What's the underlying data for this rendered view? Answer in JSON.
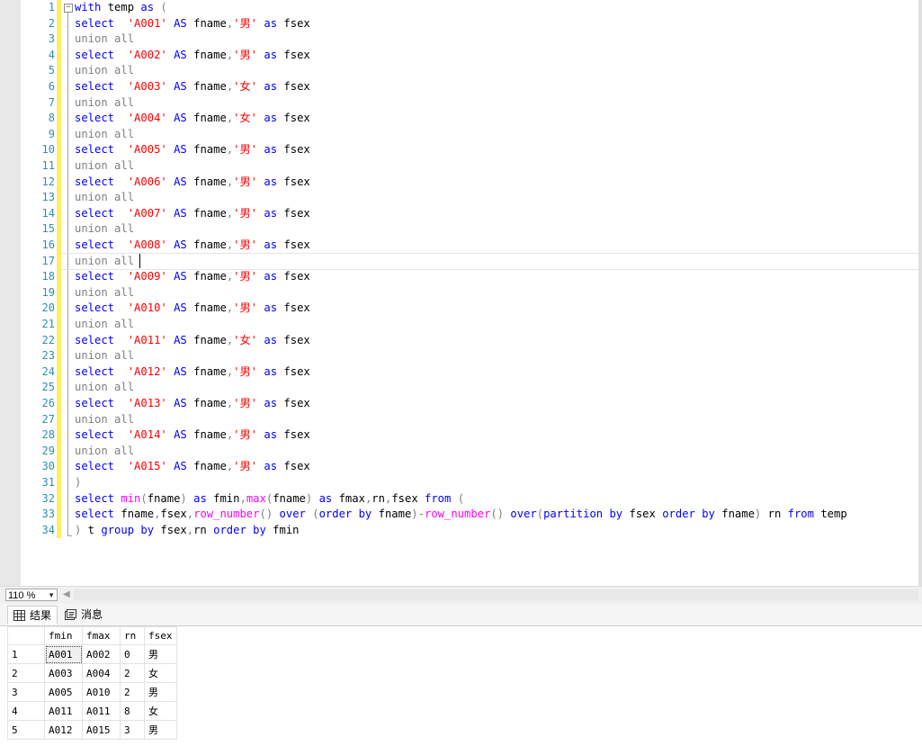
{
  "editor": {
    "line_numbers": [
      "1",
      "2",
      "3",
      "4",
      "5",
      "6",
      "7",
      "8",
      "9",
      "10",
      "11",
      "12",
      "13",
      "14",
      "15",
      "16",
      "17",
      "18",
      "19",
      "20",
      "21",
      "22",
      "23",
      "24",
      "25",
      "26",
      "27",
      "28",
      "29",
      "30",
      "31",
      "32",
      "33",
      "34"
    ],
    "outline_toggle": "−",
    "lines": [
      [
        {
          "t": "with",
          "c": "kw"
        },
        {
          "t": " temp ",
          "c": ""
        },
        {
          "t": "as",
          "c": "kw"
        },
        {
          "t": " (",
          "c": "gr"
        }
      ],
      [
        {
          "t": "select",
          "c": "kw"
        },
        {
          "t": "  ",
          "c": ""
        },
        {
          "t": "'A001'",
          "c": "st"
        },
        {
          "t": " ",
          "c": ""
        },
        {
          "t": "AS",
          "c": "kw"
        },
        {
          "t": " fname",
          "c": ""
        },
        {
          "t": ",",
          "c": "gr"
        },
        {
          "t": "'男'",
          "c": "st"
        },
        {
          "t": " ",
          "c": ""
        },
        {
          "t": "as",
          "c": "kw"
        },
        {
          "t": " fsex",
          "c": ""
        }
      ],
      [
        {
          "t": "union all",
          "c": "gr"
        }
      ],
      [
        {
          "t": "select",
          "c": "kw"
        },
        {
          "t": "  ",
          "c": ""
        },
        {
          "t": "'A002'",
          "c": "st"
        },
        {
          "t": " ",
          "c": ""
        },
        {
          "t": "AS",
          "c": "kw"
        },
        {
          "t": " fname",
          "c": ""
        },
        {
          "t": ",",
          "c": "gr"
        },
        {
          "t": "'男'",
          "c": "st"
        },
        {
          "t": " ",
          "c": ""
        },
        {
          "t": "as",
          "c": "kw"
        },
        {
          "t": " fsex",
          "c": ""
        }
      ],
      [
        {
          "t": "union all",
          "c": "gr"
        }
      ],
      [
        {
          "t": "select",
          "c": "kw"
        },
        {
          "t": "  ",
          "c": ""
        },
        {
          "t": "'A003'",
          "c": "st"
        },
        {
          "t": " ",
          "c": ""
        },
        {
          "t": "AS",
          "c": "kw"
        },
        {
          "t": " fname",
          "c": ""
        },
        {
          "t": ",",
          "c": "gr"
        },
        {
          "t": "'女'",
          "c": "st"
        },
        {
          "t": " ",
          "c": ""
        },
        {
          "t": "as",
          "c": "kw"
        },
        {
          "t": " fsex",
          "c": ""
        }
      ],
      [
        {
          "t": "union all",
          "c": "gr"
        }
      ],
      [
        {
          "t": "select",
          "c": "kw"
        },
        {
          "t": "  ",
          "c": ""
        },
        {
          "t": "'A004'",
          "c": "st"
        },
        {
          "t": " ",
          "c": ""
        },
        {
          "t": "AS",
          "c": "kw"
        },
        {
          "t": " fname",
          "c": ""
        },
        {
          "t": ",",
          "c": "gr"
        },
        {
          "t": "'女'",
          "c": "st"
        },
        {
          "t": " ",
          "c": ""
        },
        {
          "t": "as",
          "c": "kw"
        },
        {
          "t": " fsex",
          "c": ""
        }
      ],
      [
        {
          "t": "union all",
          "c": "gr"
        }
      ],
      [
        {
          "t": "select",
          "c": "kw"
        },
        {
          "t": "  ",
          "c": ""
        },
        {
          "t": "'A005'",
          "c": "st"
        },
        {
          "t": " ",
          "c": ""
        },
        {
          "t": "AS",
          "c": "kw"
        },
        {
          "t": " fname",
          "c": ""
        },
        {
          "t": ",",
          "c": "gr"
        },
        {
          "t": "'男'",
          "c": "st"
        },
        {
          "t": " ",
          "c": ""
        },
        {
          "t": "as",
          "c": "kw"
        },
        {
          "t": " fsex",
          "c": ""
        }
      ],
      [
        {
          "t": "union all",
          "c": "gr"
        }
      ],
      [
        {
          "t": "select",
          "c": "kw"
        },
        {
          "t": "  ",
          "c": ""
        },
        {
          "t": "'A006'",
          "c": "st"
        },
        {
          "t": " ",
          "c": ""
        },
        {
          "t": "AS",
          "c": "kw"
        },
        {
          "t": " fname",
          "c": ""
        },
        {
          "t": ",",
          "c": "gr"
        },
        {
          "t": "'男'",
          "c": "st"
        },
        {
          "t": " ",
          "c": ""
        },
        {
          "t": "as",
          "c": "kw"
        },
        {
          "t": " fsex",
          "c": ""
        }
      ],
      [
        {
          "t": "union all",
          "c": "gr"
        }
      ],
      [
        {
          "t": "select",
          "c": "kw"
        },
        {
          "t": "  ",
          "c": ""
        },
        {
          "t": "'A007'",
          "c": "st"
        },
        {
          "t": " ",
          "c": ""
        },
        {
          "t": "AS",
          "c": "kw"
        },
        {
          "t": " fname",
          "c": ""
        },
        {
          "t": ",",
          "c": "gr"
        },
        {
          "t": "'男'",
          "c": "st"
        },
        {
          "t": " ",
          "c": ""
        },
        {
          "t": "as",
          "c": "kw"
        },
        {
          "t": " fsex",
          "c": ""
        }
      ],
      [
        {
          "t": "union all",
          "c": "gr"
        }
      ],
      [
        {
          "t": "select",
          "c": "kw"
        },
        {
          "t": "  ",
          "c": ""
        },
        {
          "t": "'A008'",
          "c": "st"
        },
        {
          "t": " ",
          "c": ""
        },
        {
          "t": "AS",
          "c": "kw"
        },
        {
          "t": " fname",
          "c": ""
        },
        {
          "t": ",",
          "c": "gr"
        },
        {
          "t": "'男'",
          "c": "st"
        },
        {
          "t": " ",
          "c": ""
        },
        {
          "t": "as",
          "c": "kw"
        },
        {
          "t": " fsex",
          "c": ""
        }
      ],
      [
        {
          "t": "union all",
          "c": "gr"
        }
      ],
      [
        {
          "t": "select",
          "c": "kw"
        },
        {
          "t": "  ",
          "c": ""
        },
        {
          "t": "'A009'",
          "c": "st"
        },
        {
          "t": " ",
          "c": ""
        },
        {
          "t": "AS",
          "c": "kw"
        },
        {
          "t": " fname",
          "c": ""
        },
        {
          "t": ",",
          "c": "gr"
        },
        {
          "t": "'男'",
          "c": "st"
        },
        {
          "t": " ",
          "c": ""
        },
        {
          "t": "as",
          "c": "kw"
        },
        {
          "t": " fsex",
          "c": ""
        }
      ],
      [
        {
          "t": "union all",
          "c": "gr"
        }
      ],
      [
        {
          "t": "select",
          "c": "kw"
        },
        {
          "t": "  ",
          "c": ""
        },
        {
          "t": "'A010'",
          "c": "st"
        },
        {
          "t": " ",
          "c": ""
        },
        {
          "t": "AS",
          "c": "kw"
        },
        {
          "t": " fname",
          "c": ""
        },
        {
          "t": ",",
          "c": "gr"
        },
        {
          "t": "'男'",
          "c": "st"
        },
        {
          "t": " ",
          "c": ""
        },
        {
          "t": "as",
          "c": "kw"
        },
        {
          "t": " fsex",
          "c": ""
        }
      ],
      [
        {
          "t": "union all",
          "c": "gr"
        }
      ],
      [
        {
          "t": "select",
          "c": "kw"
        },
        {
          "t": "  ",
          "c": ""
        },
        {
          "t": "'A011'",
          "c": "st"
        },
        {
          "t": " ",
          "c": ""
        },
        {
          "t": "AS",
          "c": "kw"
        },
        {
          "t": " fname",
          "c": ""
        },
        {
          "t": ",",
          "c": "gr"
        },
        {
          "t": "'女'",
          "c": "st"
        },
        {
          "t": " ",
          "c": ""
        },
        {
          "t": "as",
          "c": "kw"
        },
        {
          "t": " fsex",
          "c": ""
        }
      ],
      [
        {
          "t": "union all",
          "c": "gr"
        }
      ],
      [
        {
          "t": "select",
          "c": "kw"
        },
        {
          "t": "  ",
          "c": ""
        },
        {
          "t": "'A012'",
          "c": "st"
        },
        {
          "t": " ",
          "c": ""
        },
        {
          "t": "AS",
          "c": "kw"
        },
        {
          "t": " fname",
          "c": ""
        },
        {
          "t": ",",
          "c": "gr"
        },
        {
          "t": "'男'",
          "c": "st"
        },
        {
          "t": " ",
          "c": ""
        },
        {
          "t": "as",
          "c": "kw"
        },
        {
          "t": " fsex",
          "c": ""
        }
      ],
      [
        {
          "t": "union all",
          "c": "gr"
        }
      ],
      [
        {
          "t": "select",
          "c": "kw"
        },
        {
          "t": "  ",
          "c": ""
        },
        {
          "t": "'A013'",
          "c": "st"
        },
        {
          "t": " ",
          "c": ""
        },
        {
          "t": "AS",
          "c": "kw"
        },
        {
          "t": " fname",
          "c": ""
        },
        {
          "t": ",",
          "c": "gr"
        },
        {
          "t": "'男'",
          "c": "st"
        },
        {
          "t": " ",
          "c": ""
        },
        {
          "t": "as",
          "c": "kw"
        },
        {
          "t": " fsex",
          "c": ""
        }
      ],
      [
        {
          "t": "union all",
          "c": "gr"
        }
      ],
      [
        {
          "t": "select",
          "c": "kw"
        },
        {
          "t": "  ",
          "c": ""
        },
        {
          "t": "'A014'",
          "c": "st"
        },
        {
          "t": " ",
          "c": ""
        },
        {
          "t": "AS",
          "c": "kw"
        },
        {
          "t": " fname",
          "c": ""
        },
        {
          "t": ",",
          "c": "gr"
        },
        {
          "t": "'男'",
          "c": "st"
        },
        {
          "t": " ",
          "c": ""
        },
        {
          "t": "as",
          "c": "kw"
        },
        {
          "t": " fsex",
          "c": ""
        }
      ],
      [
        {
          "t": "union all",
          "c": "gr"
        }
      ],
      [
        {
          "t": "select",
          "c": "kw"
        },
        {
          "t": "  ",
          "c": ""
        },
        {
          "t": "'A015'",
          "c": "st"
        },
        {
          "t": " ",
          "c": ""
        },
        {
          "t": "AS",
          "c": "kw"
        },
        {
          "t": " fname",
          "c": ""
        },
        {
          "t": ",",
          "c": "gr"
        },
        {
          "t": "'男'",
          "c": "st"
        },
        {
          "t": " ",
          "c": ""
        },
        {
          "t": "as",
          "c": "kw"
        },
        {
          "t": " fsex",
          "c": ""
        }
      ],
      [
        {
          "t": ")",
          "c": "gr"
        }
      ],
      [
        {
          "t": "select",
          "c": "kw"
        },
        {
          "t": " ",
          "c": ""
        },
        {
          "t": "min",
          "c": "fn"
        },
        {
          "t": "(",
          "c": "gr"
        },
        {
          "t": "fname",
          "c": ""
        },
        {
          "t": ")",
          "c": "gr"
        },
        {
          "t": " ",
          "c": ""
        },
        {
          "t": "as",
          "c": "kw"
        },
        {
          "t": " fmin",
          "c": ""
        },
        {
          "t": ",",
          "c": "gr"
        },
        {
          "t": "max",
          "c": "fn"
        },
        {
          "t": "(",
          "c": "gr"
        },
        {
          "t": "fname",
          "c": ""
        },
        {
          "t": ")",
          "c": "gr"
        },
        {
          "t": " ",
          "c": ""
        },
        {
          "t": "as",
          "c": "kw"
        },
        {
          "t": " fmax",
          "c": ""
        },
        {
          "t": ",",
          "c": "gr"
        },
        {
          "t": "rn",
          "c": ""
        },
        {
          "t": ",",
          "c": "gr"
        },
        {
          "t": "fsex ",
          "c": ""
        },
        {
          "t": "from",
          "c": "kw"
        },
        {
          "t": " (",
          "c": "gr"
        }
      ],
      [
        {
          "t": "select",
          "c": "kw"
        },
        {
          "t": " fname",
          "c": ""
        },
        {
          "t": ",",
          "c": "gr"
        },
        {
          "t": "fsex",
          "c": ""
        },
        {
          "t": ",",
          "c": "gr"
        },
        {
          "t": "row_number",
          "c": "fn"
        },
        {
          "t": "()",
          "c": "gr"
        },
        {
          "t": " ",
          "c": ""
        },
        {
          "t": "over",
          "c": "kw"
        },
        {
          "t": " (",
          "c": "gr"
        },
        {
          "t": "order by",
          "c": "kw"
        },
        {
          "t": " fname",
          "c": ""
        },
        {
          "t": ")-",
          "c": "gr"
        },
        {
          "t": "row_number",
          "c": "fn"
        },
        {
          "t": "()",
          "c": "gr"
        },
        {
          "t": " ",
          "c": ""
        },
        {
          "t": "over",
          "c": "kw"
        },
        {
          "t": "(",
          "c": "gr"
        },
        {
          "t": "partition by",
          "c": "kw"
        },
        {
          "t": " fsex ",
          "c": ""
        },
        {
          "t": "order by",
          "c": "kw"
        },
        {
          "t": " fname",
          "c": ""
        },
        {
          "t": ")",
          "c": "gr"
        },
        {
          "t": " rn ",
          "c": ""
        },
        {
          "t": "from",
          "c": "kw"
        },
        {
          "t": " temp",
          "c": ""
        }
      ],
      [
        {
          "t": ")",
          "c": "gr"
        },
        {
          "t": " t ",
          "c": ""
        },
        {
          "t": "group by",
          "c": "kw"
        },
        {
          "t": " fsex",
          "c": ""
        },
        {
          "t": ",",
          "c": "gr"
        },
        {
          "t": "rn ",
          "c": ""
        },
        {
          "t": "order by",
          "c": "kw"
        },
        {
          "t": " fmin",
          "c": ""
        }
      ]
    ]
  },
  "statusbar": {
    "zoom_label": "110 %",
    "zoom_dropdown_icon": "chevron-down-icon",
    "scroll_left_icon": "chevron-left-icon"
  },
  "tabs": [
    {
      "label": "结果",
      "icon": "grid-icon",
      "active": true
    },
    {
      "label": "消息",
      "icon": "message-icon",
      "active": false
    }
  ],
  "results": {
    "columns": [
      "fmin",
      "fmax",
      "rn",
      "fsex"
    ],
    "rows": [
      {
        "num": "1",
        "cells": [
          "A001",
          "A002",
          "0",
          "男"
        ]
      },
      {
        "num": "2",
        "cells": [
          "A003",
          "A004",
          "2",
          "女"
        ]
      },
      {
        "num": "3",
        "cells": [
          "A005",
          "A010",
          "2",
          "男"
        ]
      },
      {
        "num": "4",
        "cells": [
          "A011",
          "A011",
          "8",
          "女"
        ]
      },
      {
        "num": "5",
        "cells": [
          "A012",
          "A015",
          "3",
          "男"
        ]
      }
    ]
  },
  "colors": {
    "keyword": "#0000ff",
    "string": "#ff0000",
    "function": "#ff00ff",
    "operator": "#808080",
    "line_number": "#2b91af",
    "change_bar": "#ffee62"
  }
}
